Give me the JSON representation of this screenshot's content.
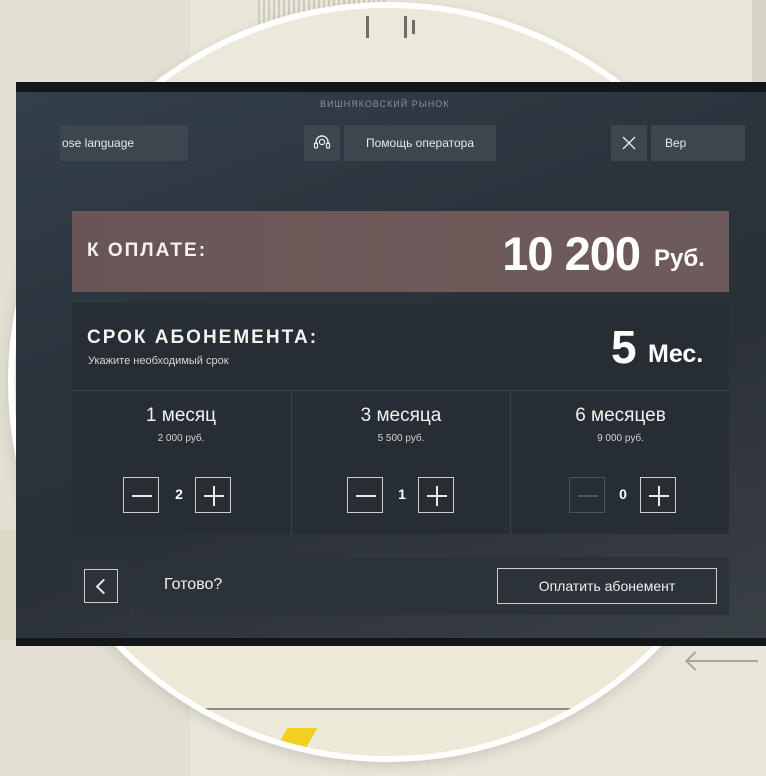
{
  "header": {
    "market_name": "ВИШНЯКОВСКИЙ РЫНОК",
    "language_button": "ose language",
    "operator_help": "Помощь оператора",
    "back_button_top": "Вер"
  },
  "payment": {
    "label": "К ОПЛАТЕ:",
    "amount": "10 200",
    "currency": "Руб."
  },
  "subscription": {
    "title": "СРОК АБОНЕМЕНТА:",
    "hint": "Укажите необходимый срок",
    "months_value": "5",
    "months_unit": "Мес.",
    "options": [
      {
        "name": "1 месяц",
        "price": "2 000 руб.",
        "qty": "2",
        "minus_enabled": true
      },
      {
        "name": "3 месяца",
        "price": "5 500 руб.",
        "qty": "1",
        "minus_enabled": true
      },
      {
        "name": "6 месяцев",
        "price": "9 000 руб.",
        "qty": "0",
        "minus_enabled": false
      }
    ]
  },
  "footer": {
    "ready_label": "Готово?",
    "pay_button": "Оплатить абонемент"
  },
  "colors": {
    "pay_panel": "#6a5556",
    "sub_panel": "#262d33",
    "screen_bg": "#2b343d"
  }
}
